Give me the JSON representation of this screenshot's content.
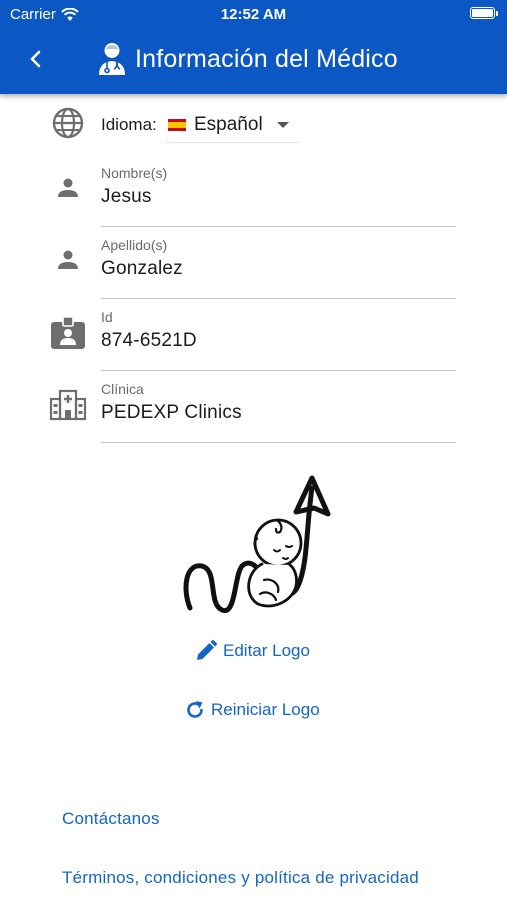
{
  "status_bar": {
    "carrier": "Carrier",
    "time": "12:52 AM"
  },
  "header": {
    "title": "Información del Médico",
    "back_icon": "chevron-left-icon",
    "title_icon": "doctor-icon"
  },
  "language": {
    "label": "Idioma:",
    "value": "Español",
    "flag": "spain-flag"
  },
  "fields": {
    "nombre": {
      "label": "Nombre(s)",
      "value": "Jesus",
      "icon": "person-icon"
    },
    "apellido": {
      "label": "Apellido(s)",
      "value": "Gonzalez",
      "icon": "person-icon"
    },
    "id": {
      "label": "Id",
      "value": "874-6521D",
      "icon": "id-badge-icon"
    },
    "clinica": {
      "label": "Clínica",
      "value": "PEDEXP Clinics",
      "icon": "hospital-icon"
    }
  },
  "logo_actions": {
    "edit": "Editar Logo",
    "reset": "Reiniciar Logo"
  },
  "links": {
    "contact": "Contáctanos",
    "terms": "Términos, condiciones y política de privacidad"
  },
  "colors": {
    "primary": "#0b57c4",
    "link": "#1466c6",
    "icon_gray": "#6e6e6e"
  }
}
